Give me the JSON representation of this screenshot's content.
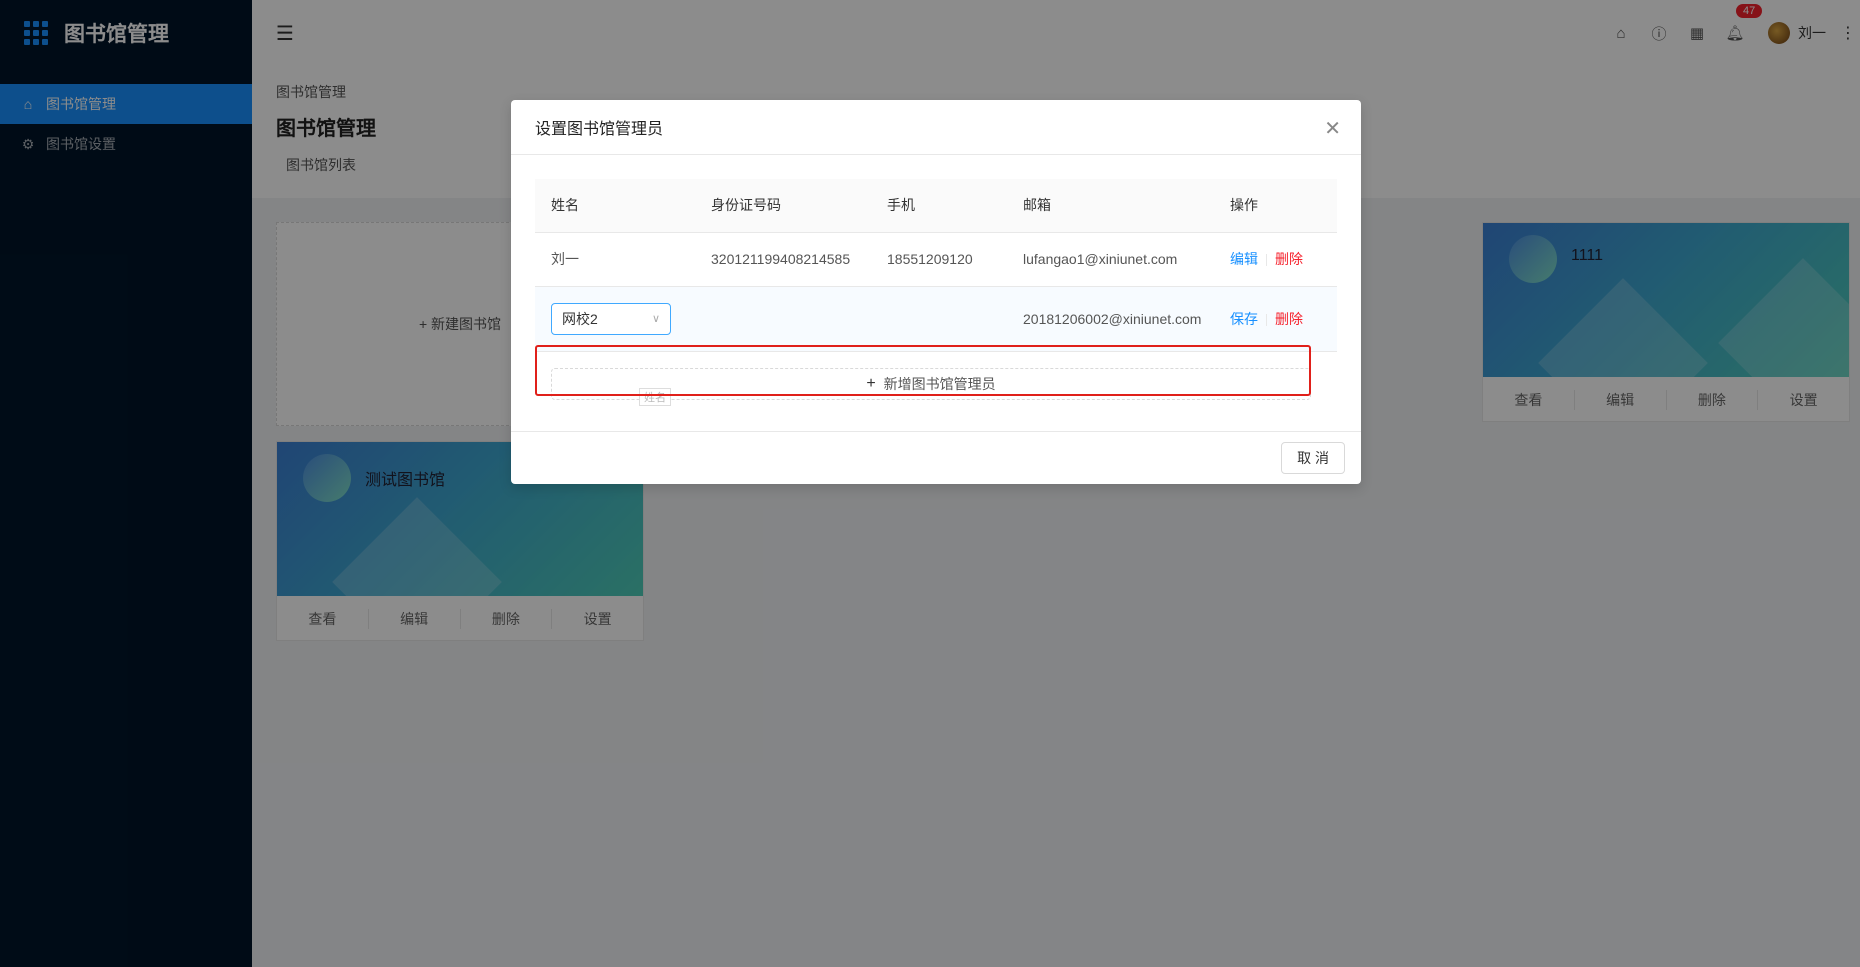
{
  "app": {
    "title": "图书馆管理"
  },
  "sidebar": {
    "items": [
      {
        "label": "图书馆管理",
        "icon": "home-icon"
      },
      {
        "label": "图书馆设置",
        "icon": "gear-icon"
      }
    ]
  },
  "header": {
    "notification_count": "47",
    "user_name": "刘一"
  },
  "page": {
    "breadcrumb": "图书馆管理",
    "title": "图书馆管理",
    "sub_tab": "图书馆列表"
  },
  "cards": {
    "new_card_label": "+ 新建图书馆",
    "items": [
      {
        "title": "1111"
      },
      {
        "title": "测试图书馆"
      }
    ],
    "actions": [
      "查看",
      "编辑",
      "删除",
      "设置"
    ]
  },
  "modal": {
    "title": "设置图书馆管理员",
    "columns": [
      "姓名",
      "身份证号码",
      "手机",
      "邮箱",
      "操作"
    ],
    "rows": [
      {
        "name": "刘一",
        "id_number": "320121199408214585",
        "phone": "18551209120",
        "email": "lufangao1@xiniunet.com",
        "action1": "编辑",
        "action2": "删除"
      }
    ],
    "edit_row": {
      "select_value": "网校2",
      "tooltip": "姓名",
      "email": "20181206002@xiniunet.com",
      "action1": "保存",
      "action2": "删除"
    },
    "add_button": "新增图书馆管理员",
    "cancel_button": "取 消"
  },
  "colors": {
    "primary": "#1890ff",
    "danger": "#f5222d",
    "sidebar_bg": "#001529",
    "highlight_border": "#e0201a"
  }
}
